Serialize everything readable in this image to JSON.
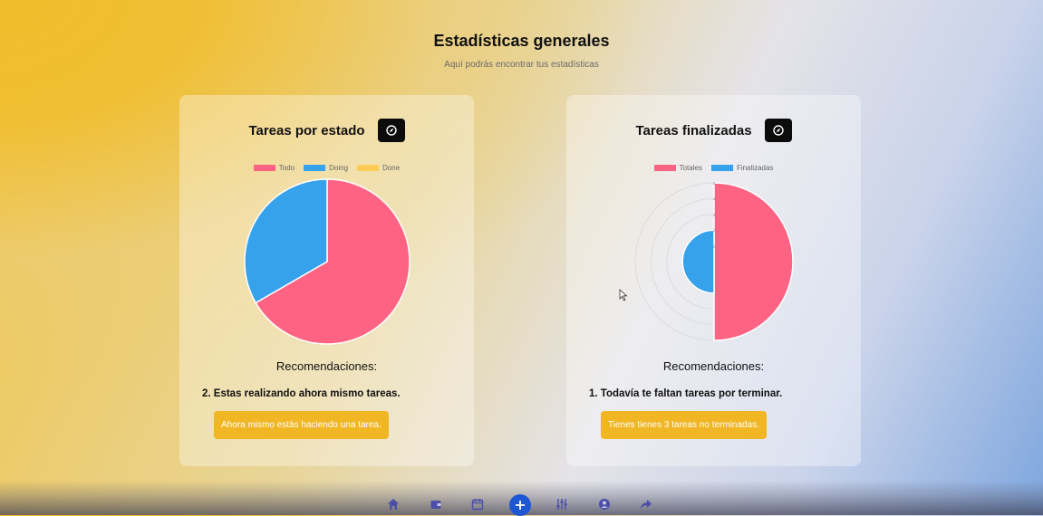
{
  "header": {
    "title": "Estadísticas generales",
    "subtitle": "Aquí podrás encontrar tus estadísticas"
  },
  "cards": [
    {
      "title": "Tareas por estado",
      "icon": "compass-icon",
      "legend": [
        "Todo",
        "Doing",
        "Done"
      ],
      "recommendations_title": "Recomendaciones:",
      "recommendation": "2. Estas realizando ahora mismo tareas.",
      "button_label": "Ahora mismo estás haciendo una tarea."
    },
    {
      "title": "Tareas finalizadas",
      "icon": "compass-icon",
      "legend": [
        "Totales",
        "Finalizadas"
      ],
      "recommendations_title": "Recomendaciones:",
      "recommendation": "1. Todavía te faltan tareas por terminar.",
      "button_label": "Tienes tienes 3 tareas no terminadas."
    }
  ],
  "chart_data": [
    {
      "type": "pie",
      "categories": [
        "Todo",
        "Doing",
        "Done"
      ],
      "values": [
        2,
        1,
        0
      ],
      "colors": [
        "#ff6384",
        "#36a2eb",
        "#ffcd56"
      ],
      "legend": "top"
    },
    {
      "type": "polarArea",
      "categories": [
        "Totales",
        "Finalizadas"
      ],
      "values": [
        5,
        2
      ],
      "rmax": 5,
      "ticks": [
        1,
        2,
        3,
        4,
        5
      ],
      "colors": [
        "#ff6384",
        "#36a2eb"
      ],
      "legend": "top"
    }
  ],
  "colors": {
    "accent": "#f0b623",
    "nav_active": "#1f56d1",
    "nav_icon": "#4b4fa8"
  },
  "navbar": {
    "icons": [
      "home-icon",
      "wallet-icon",
      "calendar-icon",
      "plus-icon",
      "sliders-icon",
      "user-icon",
      "share-icon"
    ]
  }
}
